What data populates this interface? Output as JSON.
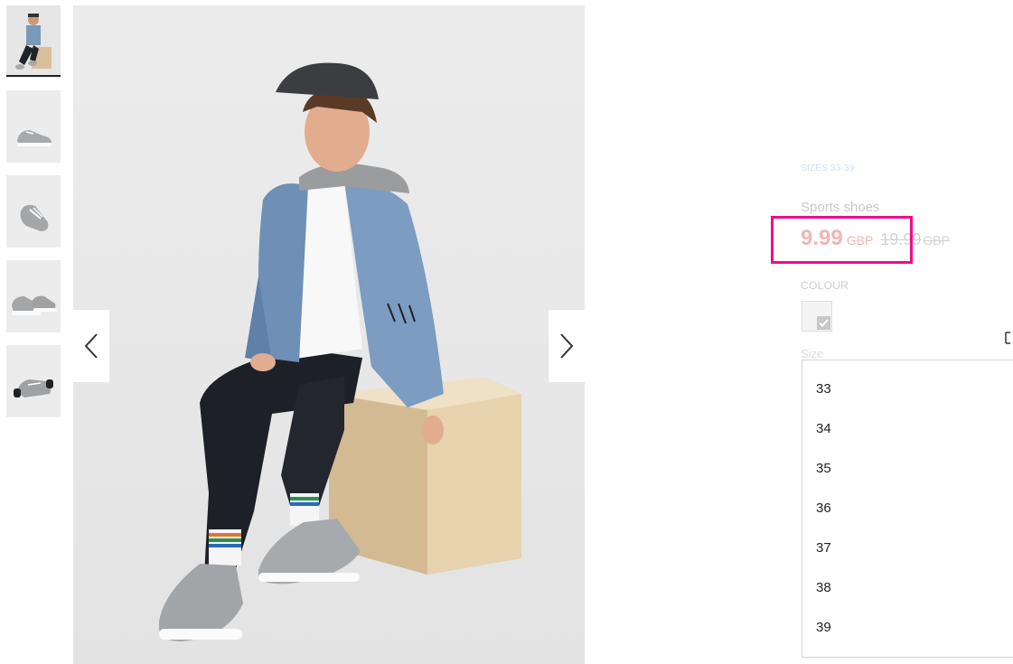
{
  "gallery": {
    "thumbnails": [
      {
        "label": "model-photo",
        "active": true
      },
      {
        "label": "shoe-side-view",
        "active": false
      },
      {
        "label": "shoe-top-view",
        "active": false
      },
      {
        "label": "shoe-pair-view",
        "active": false
      },
      {
        "label": "shoe-sole-view",
        "active": false
      }
    ],
    "prev_icon": "chevron-left-icon",
    "next_icon": "chevron-right-icon"
  },
  "product": {
    "sizes_range": "SIZES 33-39",
    "title": "Sports shoes",
    "price": "9.99",
    "price_currency": "GBP",
    "old_price": "19.99",
    "old_price_currency": "GBP",
    "colour_label": "COLOUR",
    "size_label": "Size",
    "size_options": [
      "33",
      "34",
      "35",
      "36",
      "37",
      "38",
      "39"
    ]
  },
  "colors": {
    "highlight": "#ee0c8b",
    "price": "#f3b4b4"
  }
}
